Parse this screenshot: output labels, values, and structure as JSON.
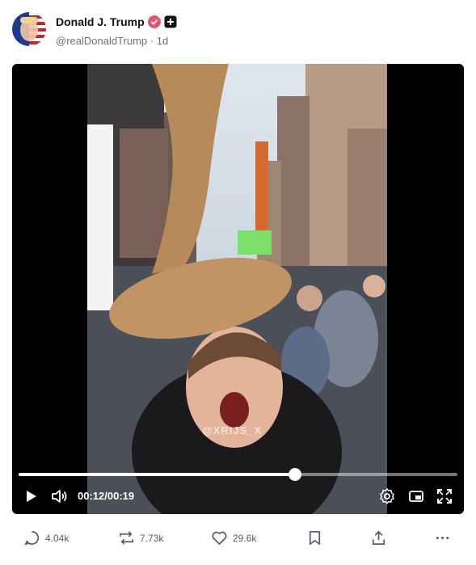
{
  "post": {
    "author_name": "Donald J. Trump",
    "handle": "@realDonaldTrump",
    "separator": "·",
    "time_ago": "1d"
  },
  "video": {
    "current_time": "00:12",
    "duration": "00:19",
    "time_sep": "/",
    "progress": 0.63,
    "watermark": "@XRIJS_X"
  },
  "actions": {
    "replies": "4.04k",
    "reposts": "7.73k",
    "likes": "29.6k"
  },
  "colors": {
    "verified_badge": "#e0566f",
    "text_secondary": "#6b7280",
    "video_bg": "#000000"
  }
}
